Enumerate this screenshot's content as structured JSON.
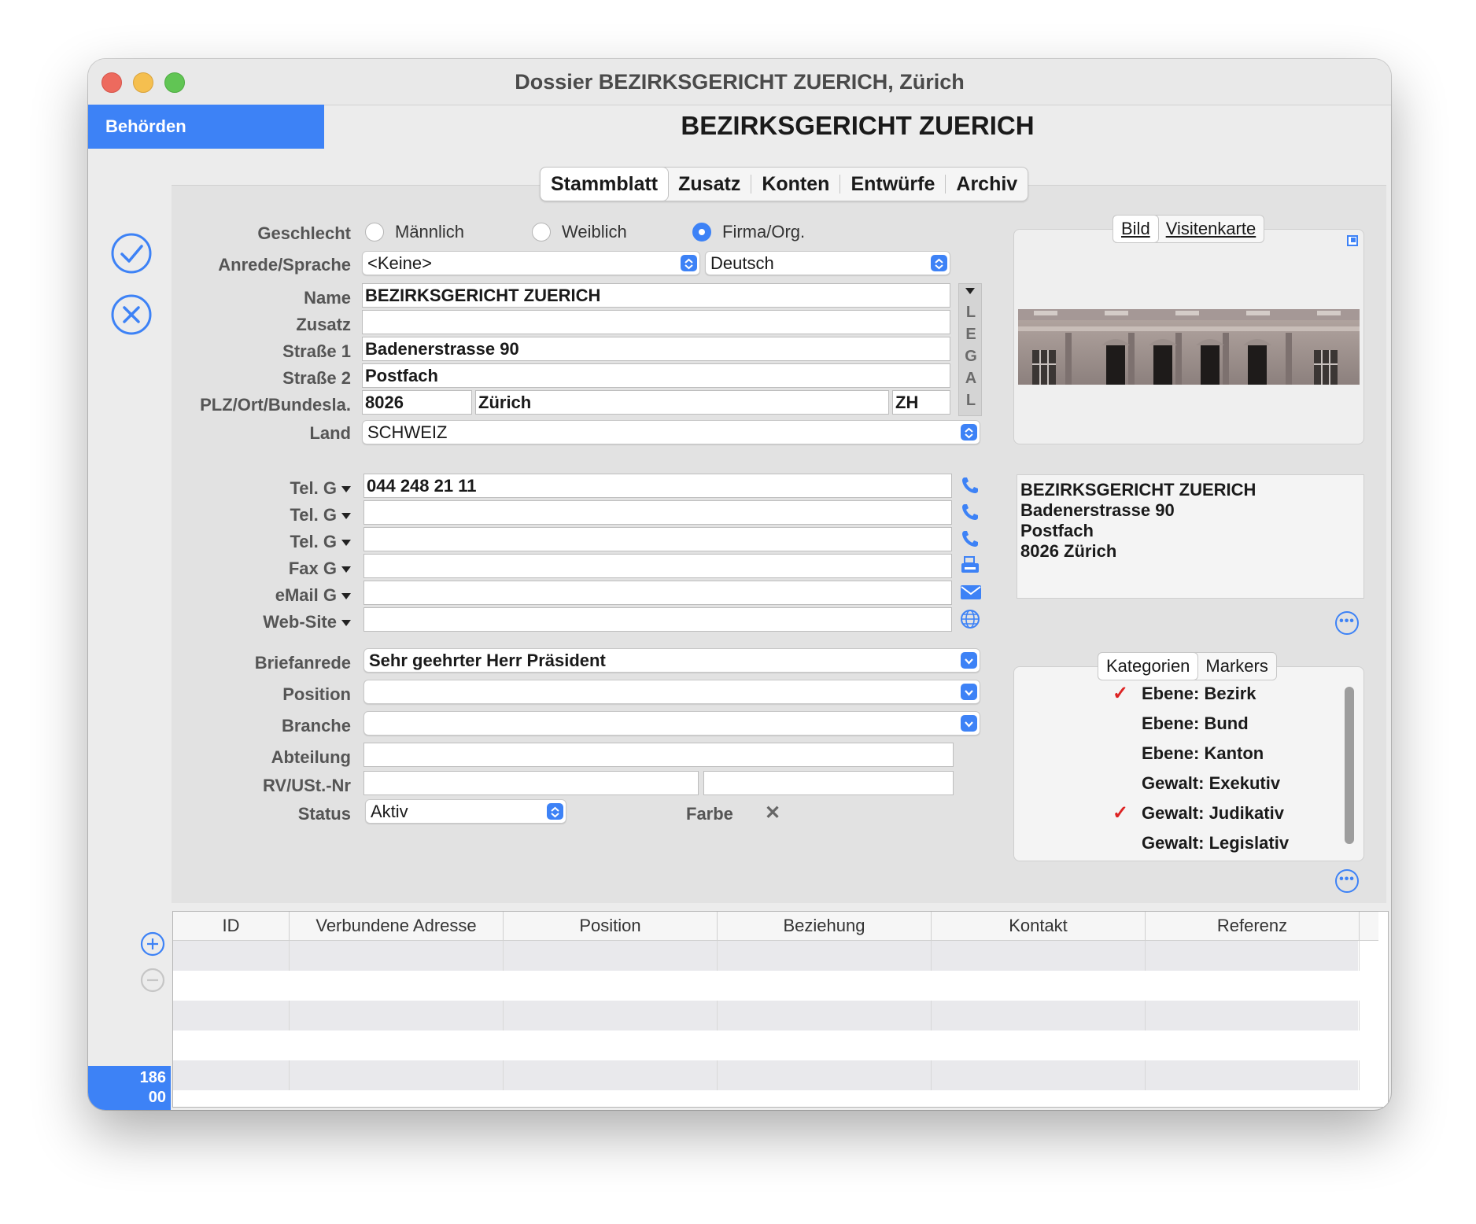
{
  "window": {
    "title": "Dossier BEZIRKSGERICHT ZUERICH, Zürich"
  },
  "sidebar": {
    "module": "Behörden",
    "counter_line1": "186",
    "counter_line2": "00"
  },
  "record": {
    "title": "BEZIRKSGERICHT ZUERICH"
  },
  "tabs": [
    {
      "label": "Stammblatt",
      "selected": true
    },
    {
      "label": "Zusatz"
    },
    {
      "label": "Konten"
    },
    {
      "label": "Entwürfe"
    },
    {
      "label": "Archiv"
    }
  ],
  "form": {
    "geschlecht": {
      "label": "Geschlecht",
      "options": [
        "Männlich",
        "Weiblich",
        "Firma/Org."
      ],
      "selected": "Firma/Org."
    },
    "anrede": {
      "label": "Anrede/Sprache",
      "value": "<Keine>",
      "sprache": "Deutsch"
    },
    "name": {
      "label": "Name",
      "value": "BEZIRKSGERICHT ZUERICH"
    },
    "zusatz": {
      "label": "Zusatz",
      "value": ""
    },
    "strasse1": {
      "label": "Straße 1",
      "value": "Badenerstrasse 90"
    },
    "strasse2": {
      "label": "Straße 2",
      "value": "Postfach"
    },
    "plzort": {
      "label": "PLZ/Ort/Bundesla.",
      "plz": "8026",
      "ort": "Zürich",
      "kanton": "ZH"
    },
    "land": {
      "label": "Land",
      "value": "SCHWEIZ"
    },
    "legal_letters": [
      "L",
      "E",
      "G",
      "A",
      "L"
    ],
    "comm": [
      {
        "label": "Tel. G",
        "value": "044 248 21 11",
        "icon": "phone-icon"
      },
      {
        "label": "Tel. G",
        "value": "",
        "icon": "phone-icon"
      },
      {
        "label": "Tel. G",
        "value": "",
        "icon": "phone-icon"
      },
      {
        "label": "Fax G",
        "value": "",
        "icon": "fax-icon"
      },
      {
        "label": "eMail G",
        "value": "",
        "icon": "mail-icon"
      },
      {
        "label": "Web-Site",
        "value": "",
        "icon": "globe-icon"
      }
    ],
    "briefanrede": {
      "label": "Briefanrede",
      "value": "Sehr geehrter Herr Präsident"
    },
    "position": {
      "label": "Position",
      "value": ""
    },
    "branche": {
      "label": "Branche",
      "value": ""
    },
    "abteilung": {
      "label": "Abteilung",
      "value": ""
    },
    "rvust": {
      "label": "RV/USt.-Nr",
      "value1": "",
      "value2": ""
    },
    "status": {
      "label": "Status",
      "value": "Aktiv"
    },
    "farbe": {
      "label": "Farbe",
      "value": "✕"
    }
  },
  "image_panel": {
    "tabs": [
      "Bild",
      "Visitenkarte"
    ]
  },
  "address_block": [
    "BEZIRKSGERICHT ZUERICH",
    "Badenerstrasse 90",
    "Postfach",
    "8026 Zürich"
  ],
  "categories": {
    "tabs": [
      "Kategorien",
      "Markers"
    ],
    "items": [
      {
        "label": "Ebene: Bezirk",
        "checked": true
      },
      {
        "label": "Ebene: Bund",
        "checked": false
      },
      {
        "label": "Ebene: Kanton",
        "checked": false
      },
      {
        "label": "Gewalt: Exekutiv",
        "checked": false
      },
      {
        "label": "Gewalt: Judikativ",
        "checked": true
      },
      {
        "label": "Gewalt: Legislativ",
        "checked": false
      }
    ],
    "check_mark": "✓"
  },
  "grid": {
    "columns": [
      "ID",
      "Verbundene Adresse",
      "Position",
      "Beziehung",
      "Kontakt",
      "Referenz"
    ]
  },
  "colors": {
    "accent": "#3d82f6",
    "check": "#dd2222"
  }
}
